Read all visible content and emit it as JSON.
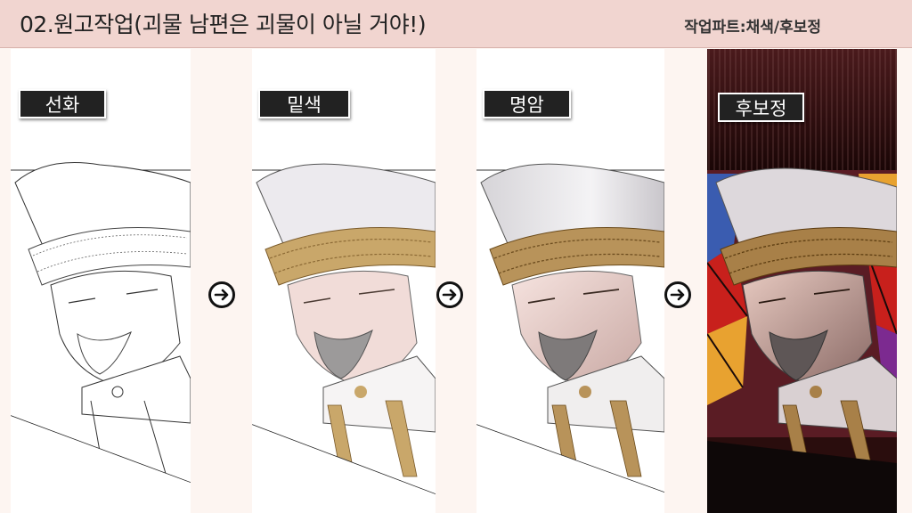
{
  "header": {
    "title": "02.원고작업(괴물 남편은 괴물이 아닐 거야!)",
    "part": "작업파트:채색/후보정"
  },
  "stages": [
    {
      "label": "선화"
    },
    {
      "label": "밑색"
    },
    {
      "label": "명암"
    },
    {
      "label": "후보정"
    }
  ],
  "icons": {
    "arrow": "circled-right-arrow-icon"
  },
  "colors": {
    "header_bg": "#f1d5d0",
    "page_bg": "#fdf5f1",
    "label_bg": "#222222",
    "gold_trim": "#b8935a",
    "stained_glass": [
      "#c8201c",
      "#e8a230",
      "#3a5cb0",
      "#7c2a90"
    ]
  }
}
